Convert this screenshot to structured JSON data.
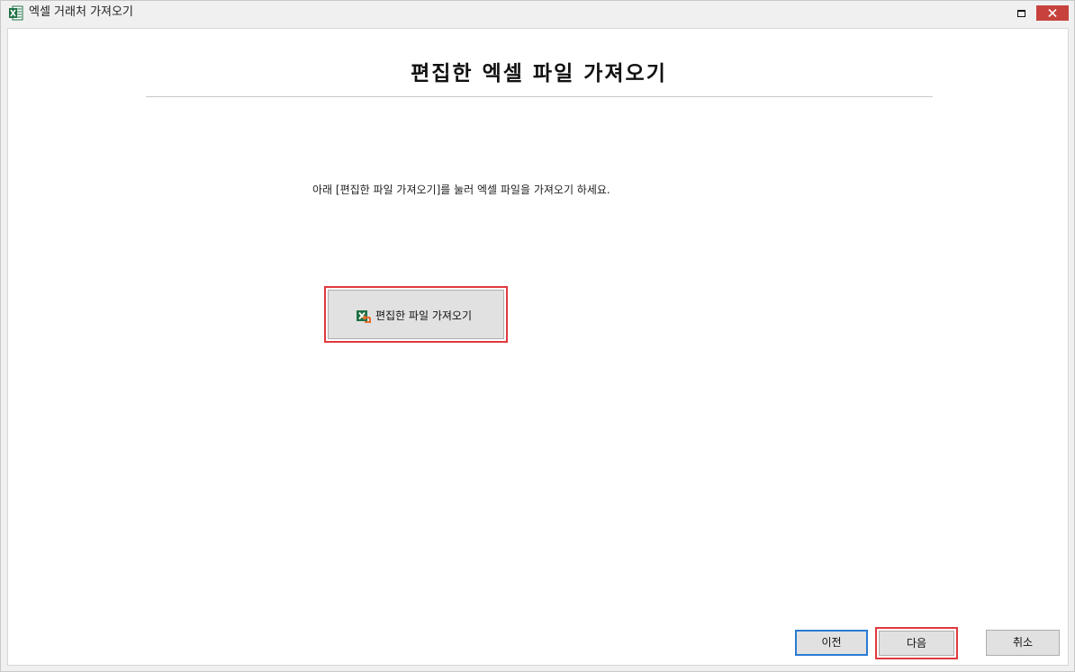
{
  "window": {
    "title": "엑셀 거래처 가져오기",
    "icon": "excel-icon",
    "controls": {
      "maximize_icon": "maximize-icon",
      "close_icon": "close-icon",
      "close_color": "#c7423c"
    }
  },
  "main": {
    "heading": "편집한 엑셀 파일 가져오기",
    "instruction": "아래 [편집한 파일 가져오기]를 눌러 엑셀 파일을 가져오기 하세요.",
    "import_button": {
      "label": "편집한 파일 가져오기",
      "icon": "excel-import-icon"
    },
    "highlight_color": "#e0393e"
  },
  "footer": {
    "prev_label": "이전",
    "next_label": "다음",
    "cancel_label": "취소",
    "focus_color": "#2a7bd4"
  }
}
